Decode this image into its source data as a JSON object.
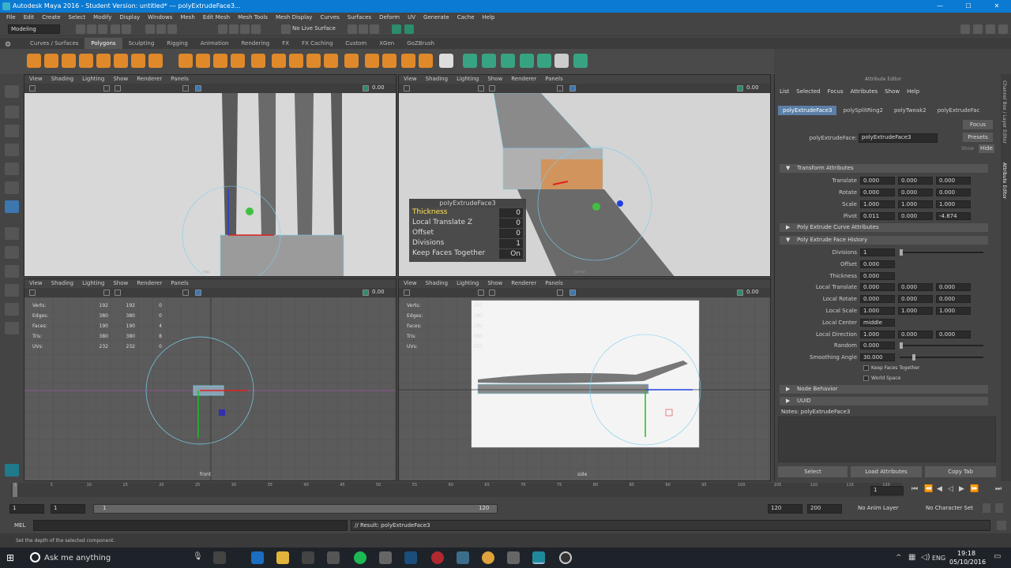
{
  "window": {
    "title": "Autodesk Maya 2016 - Student Version: untitled*   ---   polyExtrudeFace3..."
  },
  "menus": [
    "File",
    "Edit",
    "Create",
    "Select",
    "Modify",
    "Display",
    "Windows",
    "Mesh",
    "Edit Mesh",
    "Mesh Tools",
    "Mesh Display",
    "Curves",
    "Surfaces",
    "Deform",
    "UV",
    "Generate",
    "Cache",
    "Help"
  ],
  "status": {
    "mode": "Modeling",
    "live": "No Live Surface"
  },
  "shelf_tabs": [
    "Curves / Surfaces",
    "Polygons",
    "Sculpting",
    "Rigging",
    "Animation",
    "Rendering",
    "FX",
    "FX Caching",
    "Custom",
    "XGen",
    "GoZBrush"
  ],
  "shelf_active": "Polygons",
  "viewport_menu": [
    "View",
    "Shading",
    "Lighting",
    "Show",
    "Renderer",
    "Panels"
  ],
  "viewport_field": "0.00",
  "viewports": {
    "top": {
      "label": "top"
    },
    "persp": {
      "label": "persp"
    },
    "front": {
      "label": "front"
    },
    "side": {
      "label": "side"
    }
  },
  "hud_stats": {
    "labels": [
      "Verts:",
      "Edges:",
      "Faces:",
      "Tris:",
      "UVs:"
    ],
    "front": [
      [
        "192",
        "192",
        "0"
      ],
      [
        "380",
        "380",
        "0"
      ],
      [
        "190",
        "190",
        "4"
      ],
      [
        "380",
        "380",
        "8"
      ],
      [
        "232",
        "232",
        "0"
      ]
    ],
    "side": [
      [
        "192"
      ],
      [
        "380"
      ],
      [
        "190"
      ],
      [
        "380"
      ],
      [
        "232"
      ]
    ]
  },
  "poly_hud": {
    "title": "polyExtrudeFace3",
    "rows": [
      {
        "name": "Thickness",
        "value": "0"
      },
      {
        "name": "Local Translate Z",
        "value": "0"
      },
      {
        "name": "Offset",
        "value": "0"
      },
      {
        "name": "Divisions",
        "value": "1"
      },
      {
        "name": "Keep Faces Together",
        "value": "On"
      }
    ]
  },
  "attr_editor": {
    "title": "Attribute Editor",
    "menu": [
      "List",
      "Selected",
      "Focus",
      "Attributes",
      "Show",
      "Help"
    ],
    "tabs": [
      "polyExtrudeFace3",
      "polySplitRing2",
      "polyTweak2",
      "polyExtrudeFac"
    ],
    "node_label": "polyExtrudeFace:",
    "node_value": "polyExtrudeFace3",
    "focus": "Focus",
    "presets": "Presets",
    "show": "Show",
    "hide": "Hide",
    "transform_section": "Transform Attributes",
    "transform": [
      {
        "label": "Translate",
        "v": [
          "0.000",
          "0.000",
          "0.000"
        ]
      },
      {
        "label": "Rotate",
        "v": [
          "0.000",
          "0.000",
          "0.000"
        ]
      },
      {
        "label": "Scale",
        "v": [
          "1.000",
          "1.000",
          "1.000"
        ]
      },
      {
        "label": "Pivot",
        "v": [
          "0.011",
          "0.000",
          "-4.874"
        ]
      }
    ],
    "curve_section": "Poly Extrude Curve Attributes",
    "history_section": "Poly Extrude Face History",
    "history": [
      {
        "label": "Divisions",
        "v": [
          "1"
        ]
      },
      {
        "label": "Offset",
        "v": [
          "0.000"
        ]
      },
      {
        "label": "Thickness",
        "v": [
          "0.000"
        ]
      },
      {
        "label": "Local Translate",
        "v": [
          "0.000",
          "0.000",
          "0.000"
        ]
      },
      {
        "label": "Local Rotate",
        "v": [
          "0.000",
          "0.000",
          "0.000"
        ]
      },
      {
        "label": "Local Scale",
        "v": [
          "1.000",
          "1.000",
          "1.000"
        ]
      },
      {
        "label": "Local Center",
        "v": [
          "middle"
        ]
      },
      {
        "label": "Local Direction",
        "v": [
          "1.000",
          "0.000",
          "0.000"
        ]
      },
      {
        "label": "Random",
        "v": [
          "0.000"
        ]
      },
      {
        "label": "Smoothing Angle",
        "v": [
          "30.000"
        ]
      }
    ],
    "keep_faces": "Keep Faces Together",
    "world_space": "World Space",
    "node_behavior": "Node Behavior",
    "uuid": "UUID",
    "notes": "Notes:  polyExtrudeFace3",
    "buttons": [
      "Select",
      "Load Attributes",
      "Copy Tab"
    ]
  },
  "side_tabs": [
    "Channel Box / Layer Editor",
    "Attribute Editor"
  ],
  "timeslider": {
    "ticks": [
      "1",
      "5",
      "10",
      "15",
      "20",
      "25",
      "30",
      "35",
      "40",
      "45",
      "50",
      "55",
      "60",
      "65",
      "70",
      "75",
      "80",
      "85",
      "90",
      "95",
      "100",
      "105",
      "110",
      "115",
      "120"
    ],
    "current": "1"
  },
  "range": {
    "start": "1",
    "start2": "1",
    "slider_start": "1",
    "slider_end": "120",
    "end": "120",
    "end2": "200",
    "anim_layer": "No Anim Layer",
    "char_set": "No Character Set"
  },
  "cmdline": {
    "lang": "MEL",
    "result": "// Result: polyExtrudeFace3"
  },
  "helpline": "Set the depth of the selected component.",
  "taskbar": {
    "search": "Ask me anything",
    "time": "19:18",
    "date": "05/10/2016",
    "lang": "ENG"
  }
}
